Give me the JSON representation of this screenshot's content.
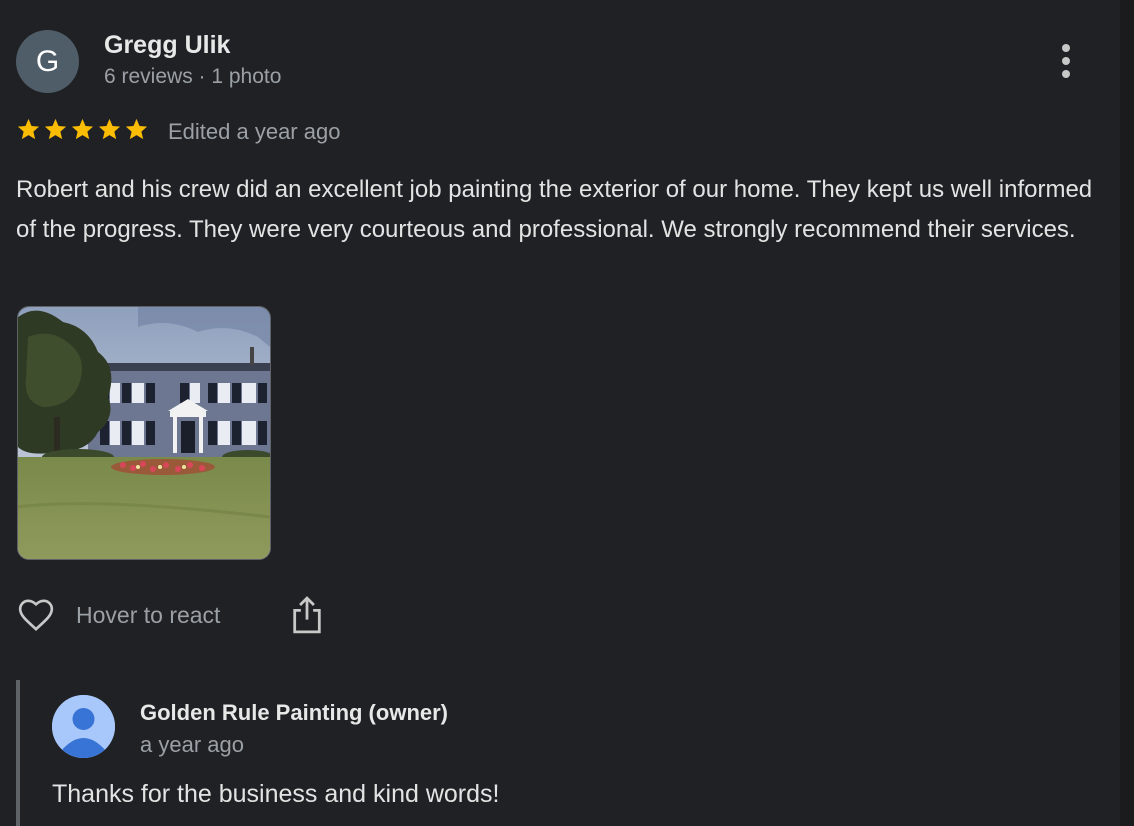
{
  "review": {
    "avatar_initial": "G",
    "reviewer_name": "Gregg Ulik",
    "reviewer_meta": "6 reviews · 1 photo",
    "rating": 5,
    "rating_max": 5,
    "edited_label": "Edited a year ago",
    "text": "Robert and his crew did an excellent job painting the exterior of our home. They kept us well informed of the progress. They were very courteous and professional. We strongly recommend their services.",
    "photo_icon": "house-photo"
  },
  "actions": {
    "react_label": "Hover to react",
    "react_icon": "heart-icon",
    "share_icon": "share-icon",
    "more_icon": "more-vert-icon"
  },
  "owner_reply": {
    "owner_name": "Golden Rule Painting (owner)",
    "time": "a year ago",
    "text": "Thanks for the business and kind words!"
  },
  "colors": {
    "background": "#202124",
    "star": "#fbbc04",
    "secondary_text": "#9aa0a6",
    "reviewer_avatar": "#4f5d68",
    "owner_avatar": "#a8c7fa"
  }
}
